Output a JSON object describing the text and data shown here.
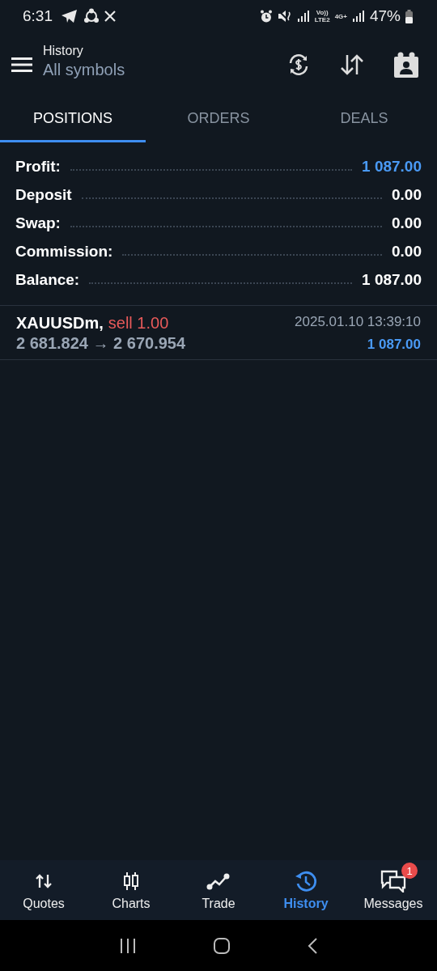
{
  "status_bar": {
    "time": "6:31",
    "volte": "Vo))\nLTE2",
    "network": "4G+",
    "battery": "47%"
  },
  "header": {
    "title": "History",
    "subtitle": "All symbols"
  },
  "tabs": [
    {
      "label": "POSITIONS",
      "selected": true
    },
    {
      "label": "ORDERS",
      "selected": false
    },
    {
      "label": "DEALS",
      "selected": false
    }
  ],
  "summary": [
    {
      "label": "Profit:",
      "value": "1 087.00",
      "color": "#4a9af5"
    },
    {
      "label": "Deposit",
      "value": "0.00",
      "color": "#ffffff"
    },
    {
      "label": "Swap:",
      "value": "0.00",
      "color": "#ffffff"
    },
    {
      "label": "Commission:",
      "value": "0.00",
      "color": "#ffffff"
    },
    {
      "label": "Balance:",
      "value": "1 087.00",
      "color": "#ffffff"
    }
  ],
  "positions": [
    {
      "symbol": "XAUUSDm,",
      "side": "sell 1.00",
      "prices": "2 681.824 → 2 670.954",
      "time": "2025.01.10 13:39:10",
      "profit": "1 087.00"
    }
  ],
  "nav": [
    {
      "label": "Quotes",
      "kind": "quotes",
      "selected": false
    },
    {
      "label": "Charts",
      "kind": "charts",
      "selected": false
    },
    {
      "label": "Trade",
      "kind": "trade",
      "selected": false
    },
    {
      "label": "History",
      "kind": "history",
      "selected": true
    },
    {
      "label": "Messages",
      "kind": "messages",
      "selected": false,
      "badge": "1"
    }
  ]
}
